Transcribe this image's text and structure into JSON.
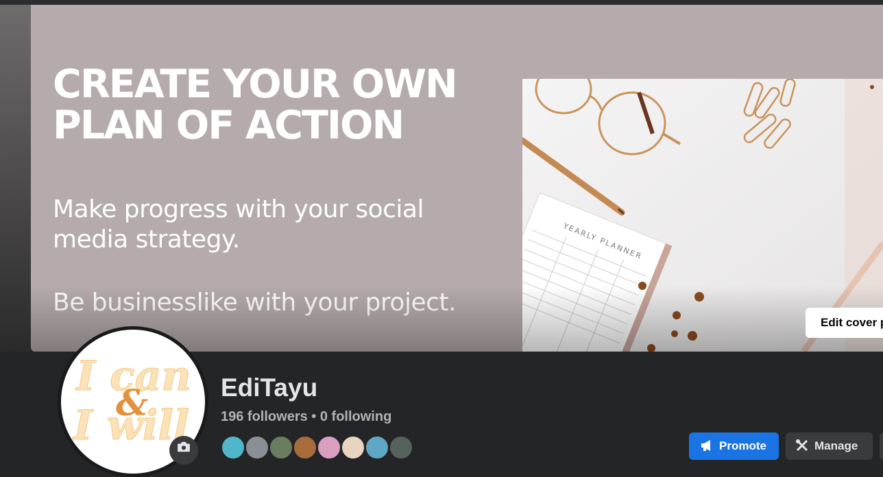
{
  "cover": {
    "headline_line1": "CREATE YOUR OWN",
    "headline_line2": "PLAN OF ACTION",
    "subline_line1": "Make progress with your social",
    "subline_line2": "media strategy.",
    "tagline": "Be businesslike with your project.",
    "planner_label": "YEARLY PLANNER",
    "edit_label": "Edit cover photo"
  },
  "profile": {
    "avatar_line1": "I can",
    "avatar_amp": "&",
    "avatar_line2": "I will",
    "name": "EdiTayu",
    "followers": "196 followers",
    "separator": "•",
    "following": "0 following"
  },
  "actions": {
    "promote_label": "Promote",
    "manage_label": "Manage"
  },
  "icons": {
    "edit_cover": "camera-icon",
    "avatar_edit": "camera-icon",
    "promote": "megaphone-icon",
    "manage": "wrench-screwdriver-icon"
  },
  "colors": {
    "page_bg": "#242526",
    "cover_bg": "#b5abac",
    "accent": "#1b74e4",
    "avatar_text": "#fbe2b8",
    "avatar_amp": "#e3923b"
  },
  "follower_avatar_colors": [
    "#4fb7c9",
    "#8a8f96",
    "#6b7d5e",
    "#a86b3c",
    "#d99fc1",
    "#e8d4c0",
    "#5fa7c4",
    "#56635c"
  ]
}
